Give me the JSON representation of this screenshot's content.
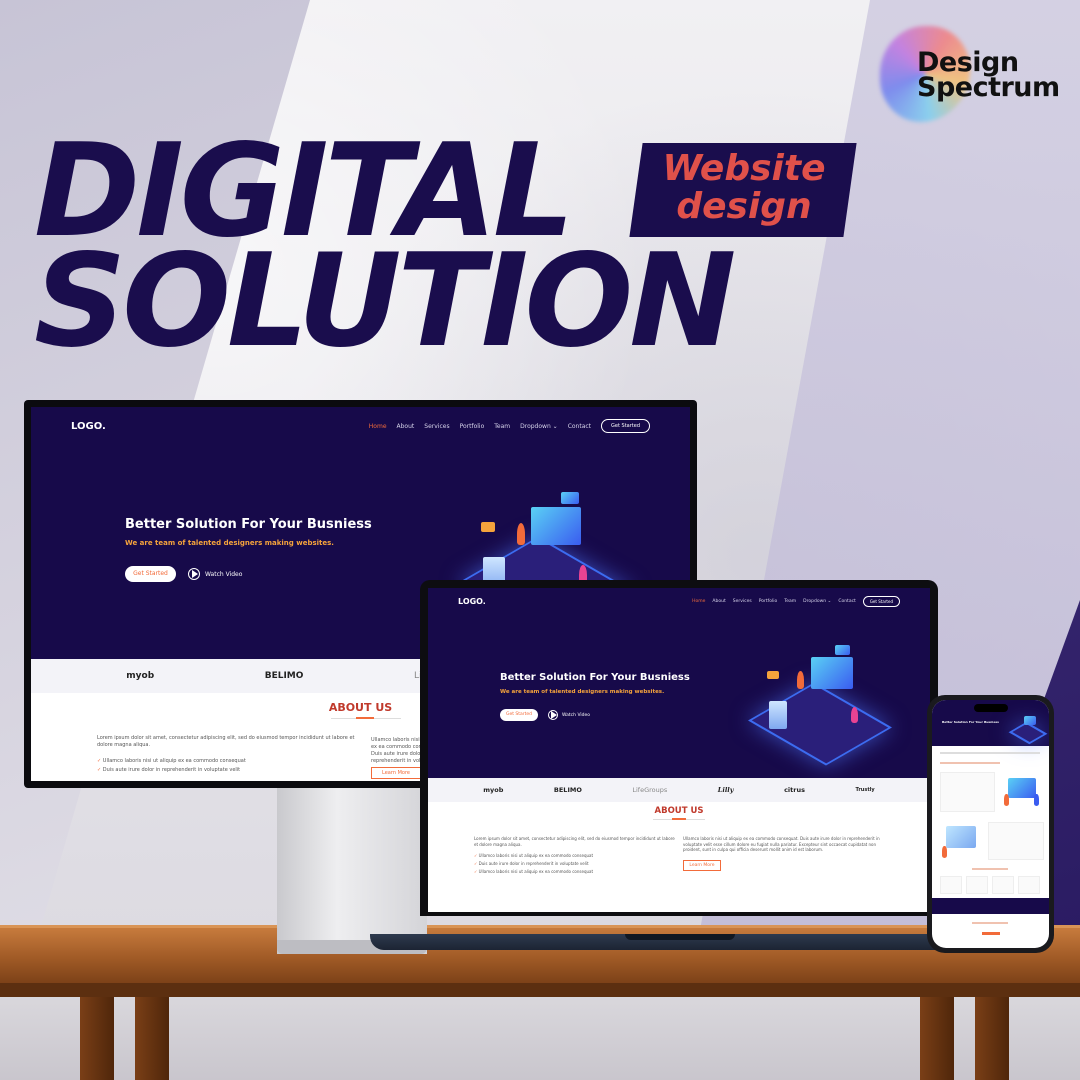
{
  "brand": {
    "line1": "Design",
    "line2": "Spectrum"
  },
  "headline": {
    "line1": "DIGITAL",
    "line2": "SOLUTION"
  },
  "tag": {
    "line1": "Website",
    "line2": "design"
  },
  "site": {
    "logo": "LOGO.",
    "nav": [
      "Home",
      "About",
      "Services",
      "Portfolio",
      "Team",
      "Dropdown ⌄",
      "Contact"
    ],
    "nav_cta": "Get Started",
    "hero_title": "Better Solution For Your Busniess",
    "hero_sub": "We are team of talented designers making websites.",
    "btn_start": "Get Started",
    "watch": "Watch Video",
    "clients": [
      "myob",
      "BELIMO",
      "LifeGroups",
      "Lilly",
      "citrus",
      "Trustly"
    ],
    "about_title": "ABOUT US",
    "about_left": "Lorem ipsum dolor sit amet, consectetur adipiscing elit, sed do eiusmod tempor incididunt ut labore et dolore magna aliqua.",
    "about_bullets": [
      "Ullamco laboris nisi ut aliquip ex ea commodo consequat",
      "Duis aute irure dolor in reprehenderit in voluptate velit",
      "Ullamco laboris nisi ut aliquip ex ea commodo consequat"
    ],
    "about_right": "Ullamco laboris nisi ut aliquip ex ea commodo consequat. Duis aute irure dolor in reprehenderit in voluptate velit esse cillum dolore eu fugiat nulla pariatur. Excepteur sint occaecat cupidatat non proident, sunt in culpa qui officia deserunt mollit anim id est laborum.",
    "learn_more": "Learn More"
  },
  "colors": {
    "navy": "#170a4a",
    "headline": "#1a0d4d",
    "accent": "#f26b3a",
    "tag_text": "#e0514a",
    "subtitle": "#f5a33c"
  }
}
